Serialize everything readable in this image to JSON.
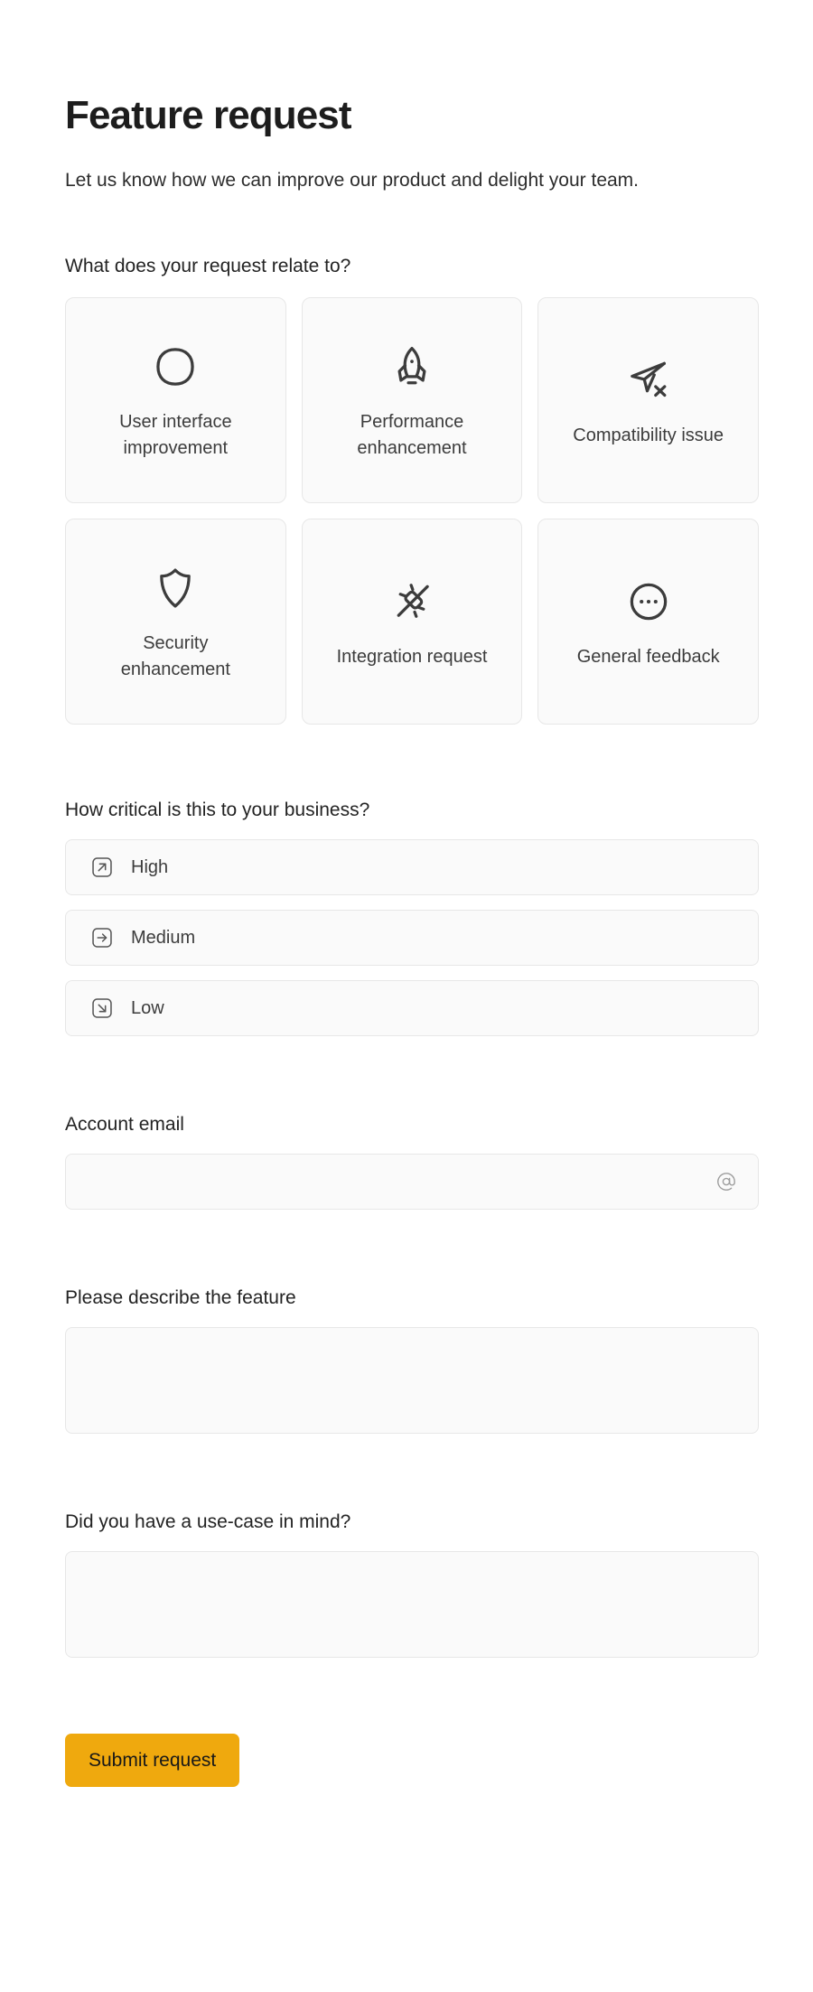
{
  "header": {
    "title": "Feature request",
    "subtitle": "Let us know how we can improve our product and delight your team."
  },
  "category": {
    "label": "What does your request relate to?",
    "options": [
      {
        "label": "User interface improvement",
        "icon": "squircle-icon"
      },
      {
        "label": "Performance enhancement",
        "icon": "rocket-icon"
      },
      {
        "label": "Compatibility issue",
        "icon": "send-x-icon"
      },
      {
        "label": "Security enhancement",
        "icon": "shield-icon"
      },
      {
        "label": "Integration request",
        "icon": "plug-disconnected-icon"
      },
      {
        "label": "General feedback",
        "icon": "dots-circle-icon"
      }
    ]
  },
  "priority": {
    "label": "How critical is this to your business?",
    "options": [
      {
        "label": "High",
        "icon": "arrow-up-right-box-icon"
      },
      {
        "label": "Medium",
        "icon": "arrow-right-box-icon"
      },
      {
        "label": "Low",
        "icon": "arrow-down-right-box-icon"
      }
    ]
  },
  "email": {
    "label": "Account email",
    "value": "",
    "placeholder": "",
    "icon": "at-sign-icon"
  },
  "description": {
    "label": "Please describe the feature",
    "value": "",
    "placeholder": ""
  },
  "usecase": {
    "label": "Did you have a use-case in mind?",
    "value": "",
    "placeholder": ""
  },
  "submit": {
    "label": "Submit request",
    "color": "#efa90e"
  },
  "colors": {
    "accent": "#efa90e",
    "card_bg": "#fafafa",
    "card_border": "#e7e7e7",
    "text": "#232323",
    "icon_stroke": "#3c3c3c"
  }
}
